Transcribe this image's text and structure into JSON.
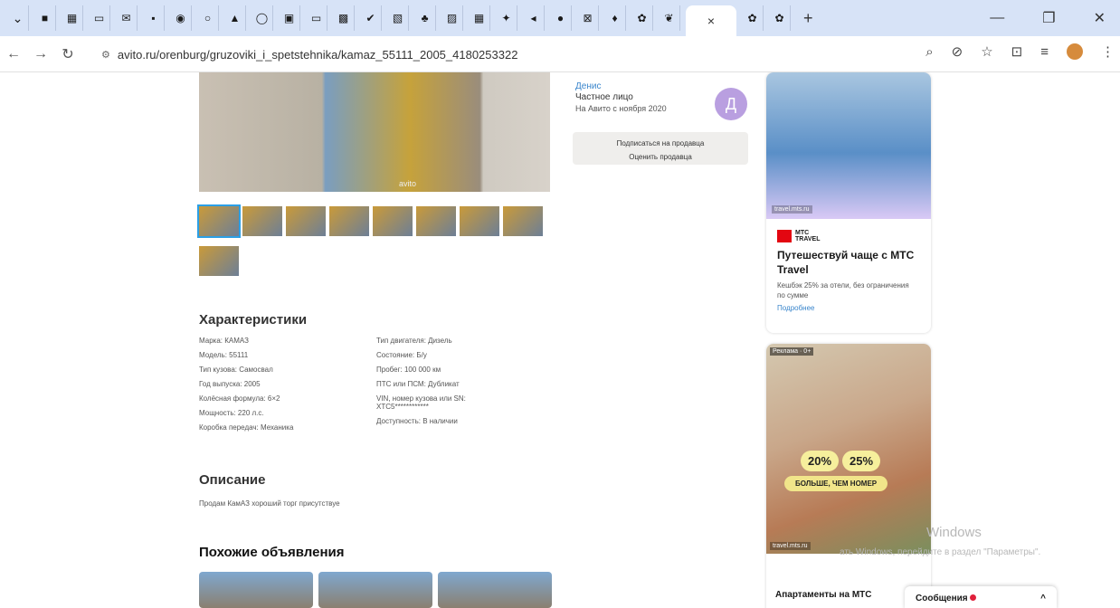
{
  "browser": {
    "tab_icons": [
      "pin-icon",
      "grid-icon",
      "monitor-icon",
      "mail-icon",
      "app-icon",
      "chrome-icon",
      "browser-icon",
      "shop-icon",
      "browser-icon",
      "app-icon",
      "window-icon",
      "app-icon",
      "check-icon",
      "app-icon",
      "tree-icon",
      "app-icon",
      "grid-icon",
      "globe-icon",
      "sound-icon",
      "media-icon",
      "mail-icon",
      "map-pin-icon",
      "app-icon",
      "leaf-icon"
    ],
    "active_tab_close": "×",
    "new_tab": "+",
    "url": "avito.ru/orenburg/gruzoviki_i_spetstehnika/kamaz_55111_2005_4180253322"
  },
  "listing": {
    "photo_watermark": "avito",
    "thumb_count": 9
  },
  "seller": {
    "name": "Денис",
    "type": "Частное лицо",
    "since": "На Авито с ноября 2020",
    "avatar_letter": "Д",
    "subscribe": "Подписаться на продавца",
    "rate": "Оценить продавца"
  },
  "characteristics": {
    "heading": "Характеристики",
    "col1": [
      "Марка: КАМАЗ",
      "Модель: 55111",
      "Тип кузова: Самосвал",
      "Год выпуска: 2005",
      "Колёсная формула: 6×2",
      "Мощность: 220 л.с.",
      "Коробка передач: Механика"
    ],
    "col2": [
      "Тип двигателя: Дизель",
      "Состояние: Б/у",
      "Пробег: 100 000 км",
      "ПТС или ПСМ: Дубликат",
      "VIN, номер кузова или SN: XTC5************",
      "Доступность: В наличии"
    ]
  },
  "description": {
    "heading": "Описание",
    "text": "Продам КамАЗ хороший торг присутствуе"
  },
  "similar": {
    "heading": "Похожие объявления"
  },
  "ad1": {
    "url": "travel.mts.ru",
    "brand_line1": "МТС",
    "brand_line2": "TRAVEL",
    "title": "Путешествуй чаще с МТС Travel",
    "body": "Кешбэк 25% за отели, без ограничения по сумме",
    "link": "Подробнее"
  },
  "ad2": {
    "tag": "Реклама · 0+",
    "pct1": "20%",
    "pct2": "25%",
    "banner": "БОЛЬШЕ, ЧЕМ НОМЕР",
    "url": "travel.mts.ru",
    "title": "Апартаменты на МТС"
  },
  "windows_watermark": {
    "line1": "Windows",
    "line2": "ать Windows, перейдите в раздел \"Параметры\"."
  },
  "messages": {
    "label": "Сообщения",
    "chevron": "^"
  },
  "colors": {
    "tabbar": "#d7e3f7",
    "link": "#3a86cc",
    "avatar": "#b99fe0",
    "mts_red": "#e30611"
  }
}
